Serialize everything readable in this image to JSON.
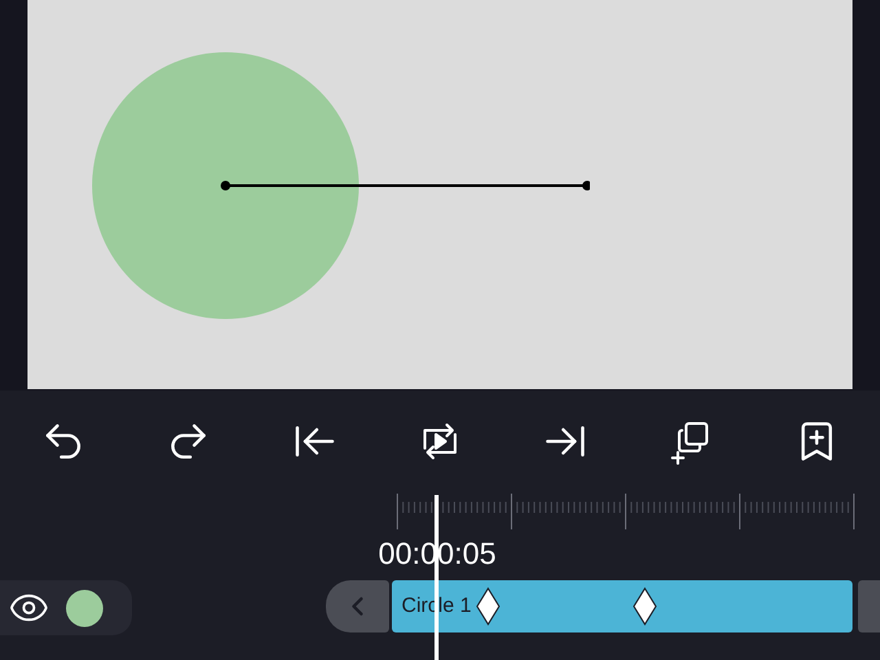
{
  "toolbar": [
    {
      "kind": "undo"
    },
    {
      "kind": "redo"
    },
    {
      "kind": "to-start"
    },
    {
      "kind": "loop-play"
    },
    {
      "kind": "to-end"
    },
    {
      "kind": "duplicate"
    },
    {
      "kind": "bookmark-add"
    }
  ],
  "timeline": {
    "time": "00:00:05"
  },
  "layer": {
    "visible": true,
    "clip_label": "Circle 1"
  }
}
